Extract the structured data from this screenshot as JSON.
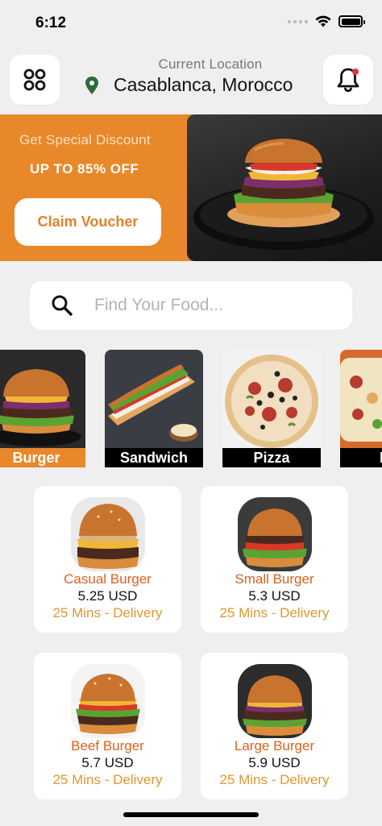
{
  "status_bar": {
    "time": "6:12"
  },
  "header": {
    "location_caption": "Current Location",
    "location_name": "Casablanca, Morocco"
  },
  "banner": {
    "subtitle": "Get Special Discount",
    "title": "UP TO 85% OFF",
    "button_label": "Claim Voucher"
  },
  "search": {
    "placeholder": "Find Your Food..."
  },
  "categories": [
    {
      "label": "Burger",
      "active": true
    },
    {
      "label": "Sandwich",
      "active": false
    },
    {
      "label": "Pizza",
      "active": false
    },
    {
      "label": "Bu",
      "active": false
    }
  ],
  "products": [
    {
      "name": "Casual Burger",
      "price": "5.25 USD",
      "delivery": "25 Mins - Delivery"
    },
    {
      "name": "Small Burger",
      "price": "5.3 USD",
      "delivery": "25 Mins - Delivery"
    },
    {
      "name": "Beef Burger",
      "price": "5.7 USD",
      "delivery": "25 Mins - Delivery"
    },
    {
      "name": "Large Burger",
      "price": "5.9 USD",
      "delivery": "25 Mins - Delivery"
    }
  ],
  "colors": {
    "accent": "#e8882a",
    "product_name": "#d9621d",
    "delivery_text": "#e0972f",
    "background": "#efefef",
    "location_pin": "#2e6b3a",
    "notification_dot": "#e2334a"
  },
  "icons": [
    "grid-menu-icon",
    "location-pin-icon",
    "bell-icon",
    "search-icon",
    "wifi-icon",
    "battery-icon"
  ]
}
